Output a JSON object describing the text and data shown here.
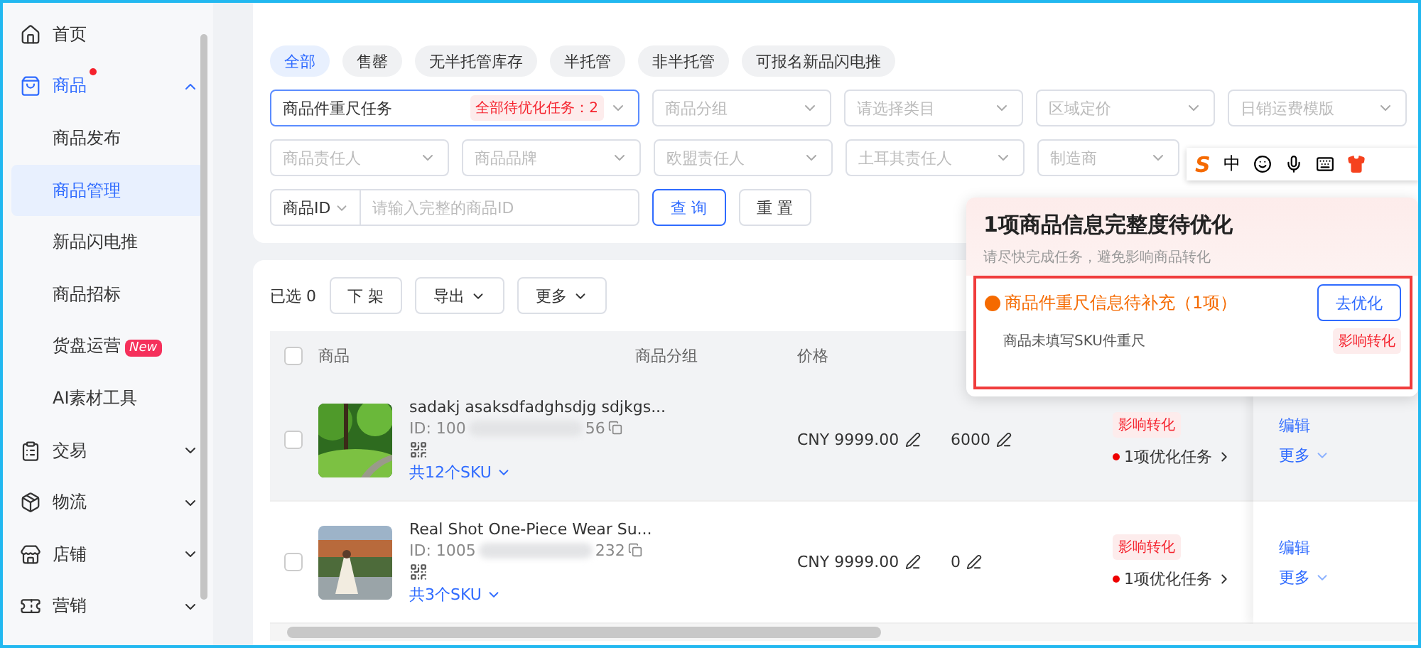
{
  "sidebar": {
    "items": [
      {
        "label": "首页",
        "selected": false,
        "dot": false
      },
      {
        "label": "商品",
        "selected": true,
        "dot": true,
        "expanded": true,
        "children": [
          {
            "label": "商品发布",
            "selected": false
          },
          {
            "label": "商品管理",
            "selected": true
          },
          {
            "label": "新品闪电推",
            "selected": false
          },
          {
            "label": "商品招标",
            "selected": false
          },
          {
            "label": "货盘运营",
            "selected": false,
            "badge": "New"
          },
          {
            "label": "AI素材工具",
            "selected": false
          }
        ]
      },
      {
        "label": "交易",
        "selected": false,
        "dot": false,
        "expanded": false
      },
      {
        "label": "物流",
        "selected": false,
        "dot": false,
        "expanded": false
      },
      {
        "label": "店铺",
        "selected": false,
        "dot": false,
        "expanded": false
      },
      {
        "label": "营销",
        "selected": false,
        "dot": false,
        "expanded": false
      }
    ]
  },
  "filters": {
    "chips": [
      {
        "label": "全部",
        "selected": true
      },
      {
        "label": "售罄",
        "selected": false
      },
      {
        "label": "无半托管库存",
        "selected": false
      },
      {
        "label": "半托管",
        "selected": false
      },
      {
        "label": "非半托管",
        "selected": false
      },
      {
        "label": "可报名新品闪电推",
        "selected": false
      }
    ],
    "task_select": {
      "value": "商品件重尺任务",
      "badge": "全部待优化任务：2"
    },
    "selects_row1": [
      {
        "placeholder": "商品分组"
      },
      {
        "placeholder": "请选择类目"
      },
      {
        "placeholder": "区域定价"
      },
      {
        "placeholder": "日销运费模版"
      }
    ],
    "selects_row2": [
      {
        "placeholder": "商品责任人"
      },
      {
        "placeholder": "商品品牌"
      },
      {
        "placeholder": "欧盟责任人"
      },
      {
        "placeholder": "土耳其责任人"
      },
      {
        "placeholder": "制造商"
      }
    ],
    "id_search": {
      "type": "商品ID",
      "placeholder": "请输入完整的商品ID"
    },
    "buttons": [
      "查 询",
      "重 置"
    ]
  },
  "toolbar": {
    "selected_count": "已选 0",
    "buttons": [
      {
        "label": "下 架",
        "dropdown": false
      },
      {
        "label": "导出",
        "dropdown": true
      },
      {
        "label": "更多",
        "dropdown": true
      }
    ]
  },
  "table": {
    "all_checked": false,
    "columns": [
      "商品",
      "商品分组",
      "价格"
    ],
    "rows": [
      {
        "checked": false,
        "highlighted": true,
        "title": "sadakj asaksdfadghsdjg sdjkgs...",
        "id_start": "ID: 100",
        "id_end": "56",
        "sku": "共12个SKU",
        "price": "CNY 9999.00",
        "stock": "6000",
        "tag": "影响转化",
        "task": "1项优化任务",
        "actions": [
          "编辑",
          "更多"
        ]
      },
      {
        "checked": false,
        "highlighted": false,
        "title": "Real Shot One-Piece Wear Su...",
        "id_start": "ID: 1005",
        "id_end": "232",
        "sku": "共3个SKU",
        "price": "CNY 9999.00",
        "stock": "0",
        "tag": "影响转化",
        "task": "1项优化任务",
        "actions": [
          "编辑",
          "更多"
        ]
      }
    ]
  },
  "ime_toolbar": {
    "logo": "S",
    "mode": "中"
  },
  "popover": {
    "title": "1项商品信息完整度待优化",
    "subtitle": "请尽快完成任务，避免影响商品转化",
    "task": {
      "title": "商品件重尺信息待补充（1项）",
      "button": "去优化",
      "detail": "商品未填写SKU件重尺",
      "tag": "影响转化"
    }
  }
}
